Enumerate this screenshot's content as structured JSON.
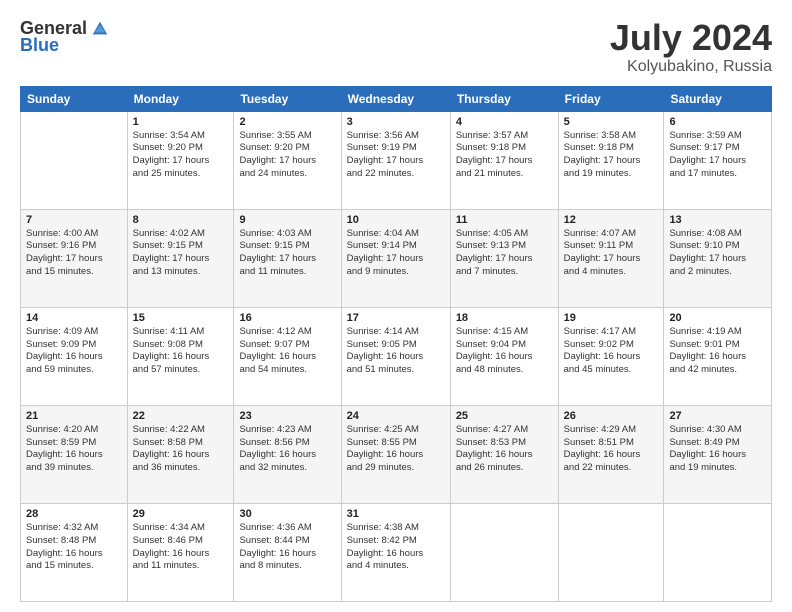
{
  "logo": {
    "general": "General",
    "blue": "Blue"
  },
  "header": {
    "month_year": "July 2024",
    "location": "Kolyubakino, Russia"
  },
  "days_of_week": [
    "Sunday",
    "Monday",
    "Tuesday",
    "Wednesday",
    "Thursday",
    "Friday",
    "Saturday"
  ],
  "weeks": [
    [
      {
        "day": "",
        "info": ""
      },
      {
        "day": "1",
        "info": "Sunrise: 3:54 AM\nSunset: 9:20 PM\nDaylight: 17 hours\nand 25 minutes."
      },
      {
        "day": "2",
        "info": "Sunrise: 3:55 AM\nSunset: 9:20 PM\nDaylight: 17 hours\nand 24 minutes."
      },
      {
        "day": "3",
        "info": "Sunrise: 3:56 AM\nSunset: 9:19 PM\nDaylight: 17 hours\nand 22 minutes."
      },
      {
        "day": "4",
        "info": "Sunrise: 3:57 AM\nSunset: 9:18 PM\nDaylight: 17 hours\nand 21 minutes."
      },
      {
        "day": "5",
        "info": "Sunrise: 3:58 AM\nSunset: 9:18 PM\nDaylight: 17 hours\nand 19 minutes."
      },
      {
        "day": "6",
        "info": "Sunrise: 3:59 AM\nSunset: 9:17 PM\nDaylight: 17 hours\nand 17 minutes."
      }
    ],
    [
      {
        "day": "7",
        "info": "Sunrise: 4:00 AM\nSunset: 9:16 PM\nDaylight: 17 hours\nand 15 minutes."
      },
      {
        "day": "8",
        "info": "Sunrise: 4:02 AM\nSunset: 9:15 PM\nDaylight: 17 hours\nand 13 minutes."
      },
      {
        "day": "9",
        "info": "Sunrise: 4:03 AM\nSunset: 9:15 PM\nDaylight: 17 hours\nand 11 minutes."
      },
      {
        "day": "10",
        "info": "Sunrise: 4:04 AM\nSunset: 9:14 PM\nDaylight: 17 hours\nand 9 minutes."
      },
      {
        "day": "11",
        "info": "Sunrise: 4:05 AM\nSunset: 9:13 PM\nDaylight: 17 hours\nand 7 minutes."
      },
      {
        "day": "12",
        "info": "Sunrise: 4:07 AM\nSunset: 9:11 PM\nDaylight: 17 hours\nand 4 minutes."
      },
      {
        "day": "13",
        "info": "Sunrise: 4:08 AM\nSunset: 9:10 PM\nDaylight: 17 hours\nand 2 minutes."
      }
    ],
    [
      {
        "day": "14",
        "info": "Sunrise: 4:09 AM\nSunset: 9:09 PM\nDaylight: 16 hours\nand 59 minutes."
      },
      {
        "day": "15",
        "info": "Sunrise: 4:11 AM\nSunset: 9:08 PM\nDaylight: 16 hours\nand 57 minutes."
      },
      {
        "day": "16",
        "info": "Sunrise: 4:12 AM\nSunset: 9:07 PM\nDaylight: 16 hours\nand 54 minutes."
      },
      {
        "day": "17",
        "info": "Sunrise: 4:14 AM\nSunset: 9:05 PM\nDaylight: 16 hours\nand 51 minutes."
      },
      {
        "day": "18",
        "info": "Sunrise: 4:15 AM\nSunset: 9:04 PM\nDaylight: 16 hours\nand 48 minutes."
      },
      {
        "day": "19",
        "info": "Sunrise: 4:17 AM\nSunset: 9:02 PM\nDaylight: 16 hours\nand 45 minutes."
      },
      {
        "day": "20",
        "info": "Sunrise: 4:19 AM\nSunset: 9:01 PM\nDaylight: 16 hours\nand 42 minutes."
      }
    ],
    [
      {
        "day": "21",
        "info": "Sunrise: 4:20 AM\nSunset: 8:59 PM\nDaylight: 16 hours\nand 39 minutes."
      },
      {
        "day": "22",
        "info": "Sunrise: 4:22 AM\nSunset: 8:58 PM\nDaylight: 16 hours\nand 36 minutes."
      },
      {
        "day": "23",
        "info": "Sunrise: 4:23 AM\nSunset: 8:56 PM\nDaylight: 16 hours\nand 32 minutes."
      },
      {
        "day": "24",
        "info": "Sunrise: 4:25 AM\nSunset: 8:55 PM\nDaylight: 16 hours\nand 29 minutes."
      },
      {
        "day": "25",
        "info": "Sunrise: 4:27 AM\nSunset: 8:53 PM\nDaylight: 16 hours\nand 26 minutes."
      },
      {
        "day": "26",
        "info": "Sunrise: 4:29 AM\nSunset: 8:51 PM\nDaylight: 16 hours\nand 22 minutes."
      },
      {
        "day": "27",
        "info": "Sunrise: 4:30 AM\nSunset: 8:49 PM\nDaylight: 16 hours\nand 19 minutes."
      }
    ],
    [
      {
        "day": "28",
        "info": "Sunrise: 4:32 AM\nSunset: 8:48 PM\nDaylight: 16 hours\nand 15 minutes."
      },
      {
        "day": "29",
        "info": "Sunrise: 4:34 AM\nSunset: 8:46 PM\nDaylight: 16 hours\nand 11 minutes."
      },
      {
        "day": "30",
        "info": "Sunrise: 4:36 AM\nSunset: 8:44 PM\nDaylight: 16 hours\nand 8 minutes."
      },
      {
        "day": "31",
        "info": "Sunrise: 4:38 AM\nSunset: 8:42 PM\nDaylight: 16 hours\nand 4 minutes."
      },
      {
        "day": "",
        "info": ""
      },
      {
        "day": "",
        "info": ""
      },
      {
        "day": "",
        "info": ""
      }
    ]
  ]
}
